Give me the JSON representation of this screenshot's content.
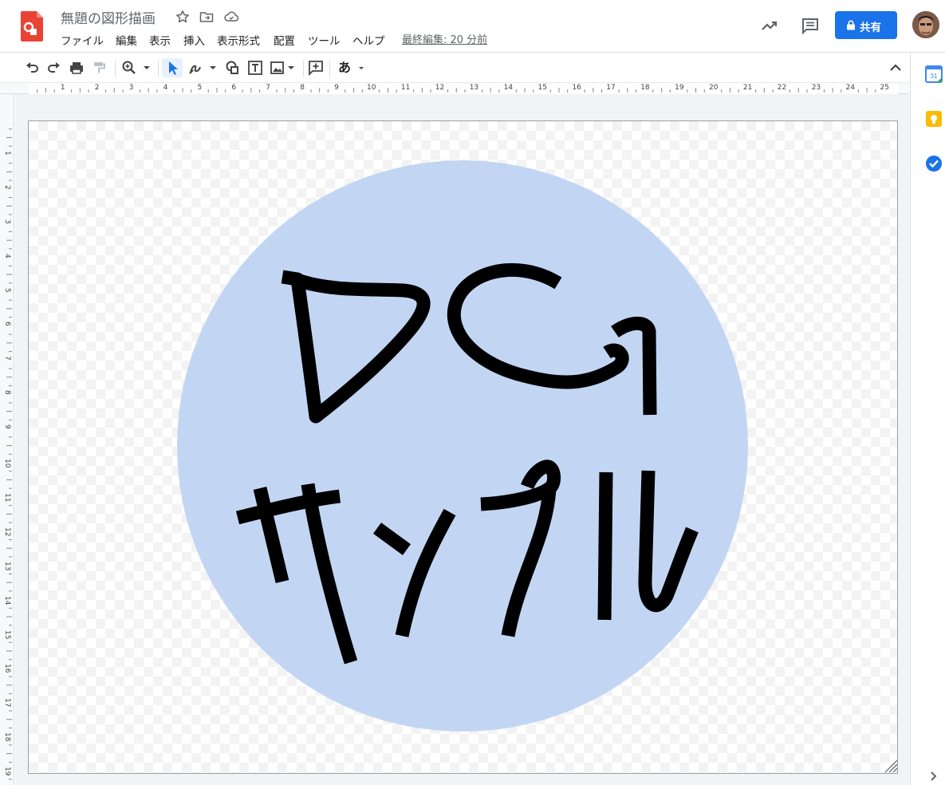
{
  "header": {
    "doc_title": "無題の図形描画",
    "menu": [
      "ファイル",
      "編集",
      "表示",
      "挿入",
      "表示形式",
      "配置",
      "ツール",
      "ヘルプ"
    ],
    "last_edit": "最終編集: 20 分前",
    "share_label": "共有",
    "title_icons": [
      "star-icon",
      "move-to-folder-icon",
      "cloud-saved-icon"
    ],
    "right_icons": [
      "activity-trend-icon",
      "comment-icon"
    ]
  },
  "toolbar": {
    "tools": [
      "undo-icon",
      "redo-icon",
      "print-icon",
      "paint-format-icon",
      "zoom-icon",
      "select-icon",
      "line-scribble-icon",
      "shape-icon",
      "text-box-icon",
      "image-icon",
      "add-comment-icon",
      "text-input-icon"
    ],
    "input_label": "あ"
  },
  "ruler": {
    "horizontal": [
      "1",
      "2",
      "3",
      "4",
      "5",
      "6",
      "7",
      "8",
      "9",
      "10",
      "11",
      "12",
      "13",
      "14",
      "15",
      "16",
      "17",
      "18",
      "19",
      "20",
      "21",
      "22",
      "23",
      "24",
      "25"
    ],
    "vertical": [
      "1",
      "2",
      "3",
      "4",
      "5",
      "6",
      "7",
      "8",
      "9",
      "10",
      "11",
      "12",
      "13",
      "14",
      "15",
      "16",
      "17",
      "18",
      "19"
    ]
  },
  "canvas": {
    "circle_fill": "#c2d6f4",
    "stroke_color": "#000000"
  },
  "side_panel": [
    "calendar-icon",
    "keep-icon",
    "tasks-icon"
  ],
  "colors": {
    "accent": "#1a73e8",
    "doc_red": "#ea4335"
  }
}
